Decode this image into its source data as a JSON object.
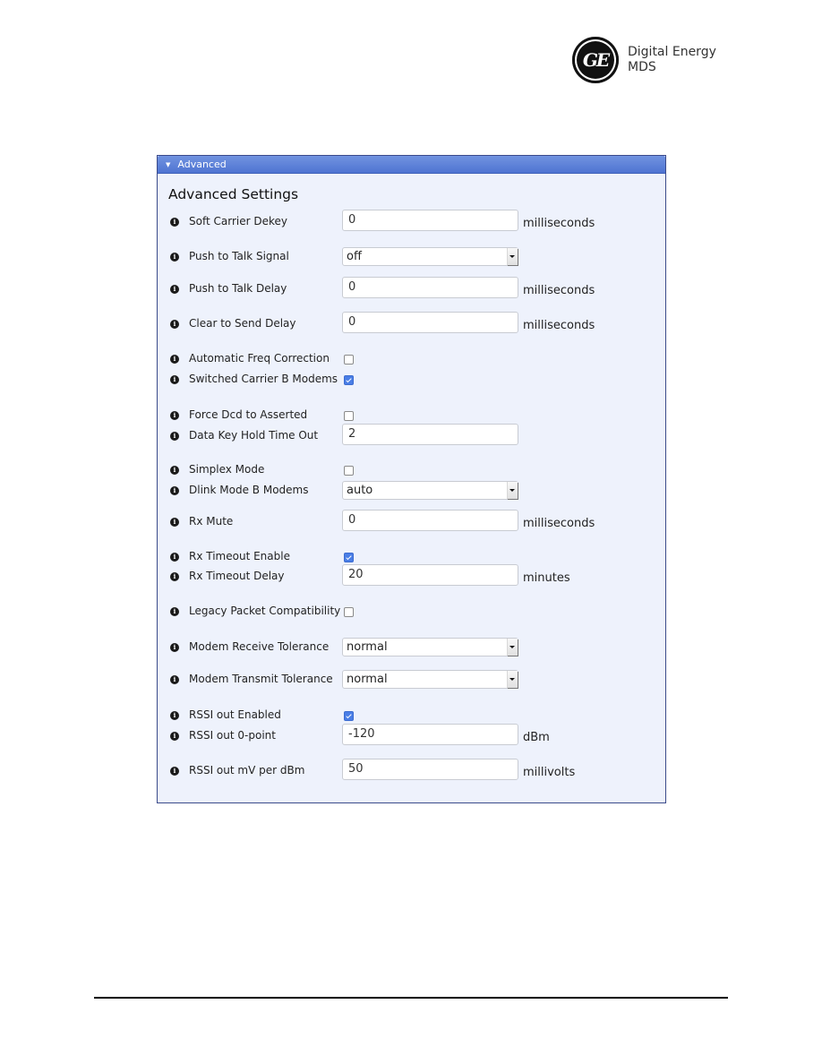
{
  "logo": {
    "mark": "GE",
    "line1": "Digital Energy",
    "line2": "MDS"
  },
  "panel": {
    "header_label": "Advanced",
    "title": "Advanced Settings",
    "theme": {
      "header": "#5a7ed8",
      "background": "#eef2fc",
      "check": "#4a7ee6"
    }
  },
  "settings": [
    {
      "label": "Soft Carrier Dekey",
      "type": "text",
      "value": "0",
      "unit": "milliseconds"
    },
    {
      "label": "Push to Talk Signal",
      "type": "select",
      "value": "off"
    },
    {
      "label": "Push to Talk Delay",
      "type": "text",
      "value": "0",
      "unit": "milliseconds"
    },
    {
      "label": "Clear to Send Delay",
      "type": "text",
      "value": "0",
      "unit": "milliseconds"
    },
    {
      "label": "Automatic Freq Correction",
      "type": "checkbox",
      "checked": false
    },
    {
      "label": "Switched Carrier B Modems",
      "type": "checkbox",
      "checked": true
    },
    {
      "label": "Force Dcd to Asserted",
      "type": "checkbox",
      "checked": false
    },
    {
      "label": "Data Key Hold Time Out",
      "type": "text",
      "value": "2"
    },
    {
      "label": "Simplex Mode",
      "type": "checkbox",
      "checked": false
    },
    {
      "label": "Dlink Mode B Modems",
      "type": "select",
      "value": "auto"
    },
    {
      "label": "Rx Mute",
      "type": "text",
      "value": "0",
      "unit": "milliseconds"
    },
    {
      "label": "Rx Timeout Enable",
      "type": "checkbox",
      "checked": true
    },
    {
      "label": "Rx Timeout Delay",
      "type": "text",
      "value": "20",
      "unit": "minutes"
    },
    {
      "label": "Legacy Packet Compatibility",
      "type": "checkbox",
      "checked": false
    },
    {
      "label": "Modem Receive Tolerance",
      "type": "select",
      "value": "normal"
    },
    {
      "label": "Modem Transmit Tolerance",
      "type": "select",
      "value": "normal"
    },
    {
      "label": "RSSI out Enabled",
      "type": "checkbox",
      "checked": true
    },
    {
      "label": "RSSI out 0-point",
      "type": "text",
      "value": "-120",
      "unit": "dBm"
    },
    {
      "label": "RSSI out mV per dBm",
      "type": "text",
      "value": "50",
      "unit": "millivolts"
    }
  ]
}
